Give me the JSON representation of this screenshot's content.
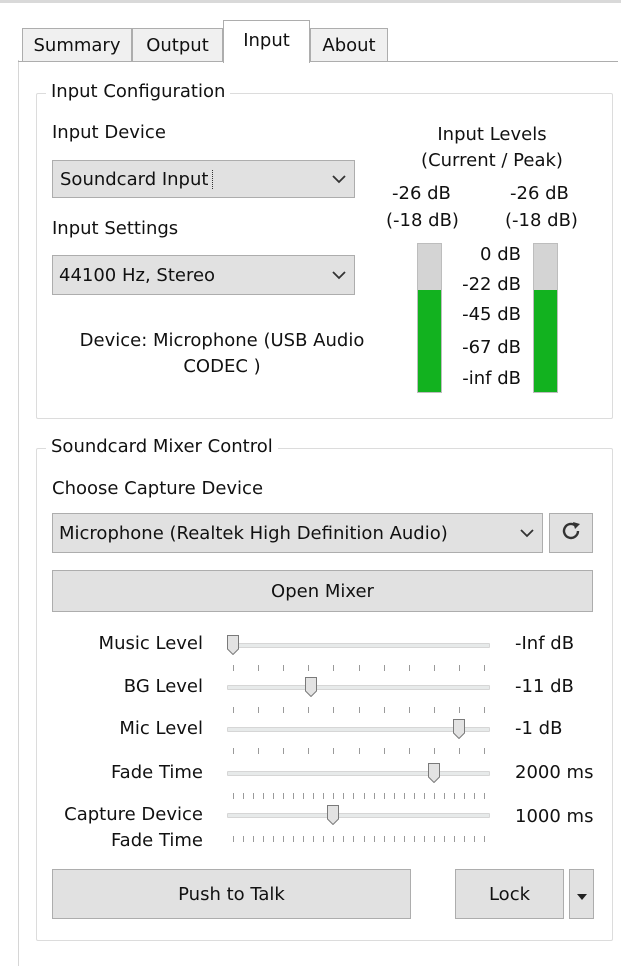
{
  "tabs": [
    {
      "label": "Summary",
      "active": false
    },
    {
      "label": "Output",
      "active": false
    },
    {
      "label": "Input",
      "active": true
    },
    {
      "label": "About",
      "active": false
    }
  ],
  "input_config": {
    "title": "Input Configuration",
    "device_label": "Input Device",
    "device_value": "Soundcard Input",
    "settings_label": "Input Settings",
    "settings_value": "44100 Hz, Stereo",
    "device_info_line1": "Device: Microphone (USB Audio",
    "device_info_line2": "CODEC )",
    "levels_title_line1": "Input Levels",
    "levels_title_line2": "(Current / Peak)",
    "left_current": "-26 dB",
    "left_peak": "(-18 dB)",
    "right_current": "-26 dB",
    "right_peak": "(-18 dB)",
    "scale": [
      "0 dB",
      "-22 dB",
      "-45 dB",
      "-67 dB",
      "-inf dB"
    ],
    "left_level_fraction": 0.69,
    "right_level_fraction": 0.69,
    "meter_color": "#12b21f"
  },
  "mixer": {
    "title": "Soundcard Mixer Control",
    "capture_label": "Choose Capture Device",
    "capture_value": "Microphone (Realtek High Definition Audio)",
    "refresh_icon": "refresh-icon",
    "open_mixer_label": "Open Mixer",
    "sliders": [
      {
        "label": "Music Level",
        "value": "-Inf dB",
        "position": 0.0
      },
      {
        "label": "BG Level",
        "value": "-11 dB",
        "position": 0.31
      },
      {
        "label": "Mic Level",
        "value": "-1 dB",
        "position": 0.9
      },
      {
        "label": "Fade Time",
        "value": "2000 ms",
        "position": 0.8
      },
      {
        "label_line1": "Capture Device",
        "label_line2": "Fade Time",
        "value": "1000 ms",
        "position": 0.4
      }
    ],
    "push_to_talk_label": "Push to Talk",
    "lock_label": "Lock",
    "lock_menu_icon": "caret-down-icon"
  }
}
